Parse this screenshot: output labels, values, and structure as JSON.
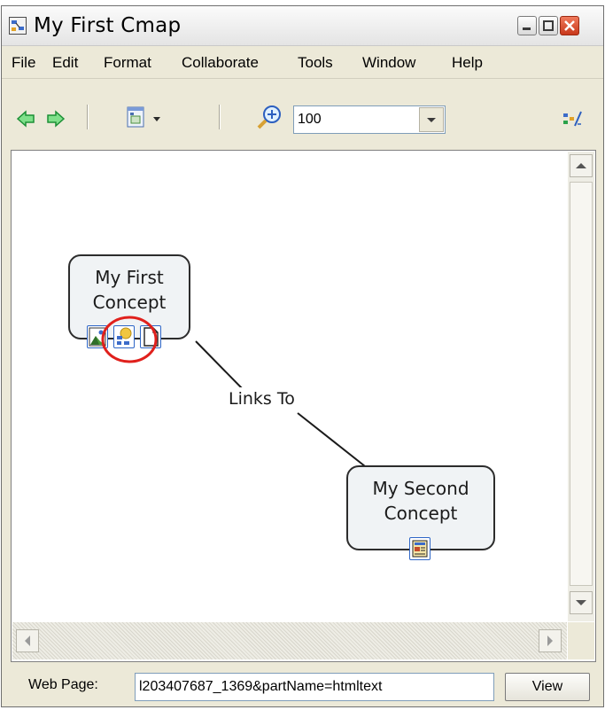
{
  "window": {
    "title": "My First Cmap",
    "controls": {
      "minimize": "minimize-icon",
      "maximize": "maximize-icon",
      "close": "close-icon"
    }
  },
  "menu": {
    "items": [
      {
        "label": "File"
      },
      {
        "label": "Edit"
      },
      {
        "label": "Format"
      },
      {
        "label": "Collaborate"
      },
      {
        "label": "Tools"
      },
      {
        "label": "Window"
      },
      {
        "label": "Help"
      }
    ]
  },
  "toolbar": {
    "icons": [
      "back-arrow-icon",
      "forward-arrow-icon",
      "view-options-icon",
      "zoom-in-icon",
      "styles-icon"
    ],
    "zoom_value": "100"
  },
  "cmap": {
    "concept_1": {
      "line1": "My First",
      "line2": "Concept",
      "resources": [
        "image-resource-icon",
        "cmap-resource-icon",
        "document-resource-icon"
      ]
    },
    "link_label": "Links To",
    "concept_2": {
      "line1": "My Second",
      "line2": "Concept",
      "resources": [
        "webpage-resource-icon"
      ]
    },
    "highlight_color": "#e0201c"
  },
  "status": {
    "label": "Web Page:",
    "value": "l203407687_1369&partName=htmltext",
    "view_button": "View"
  },
  "colors": {
    "window_bg": "#ece9d8",
    "arrow_green": "#2fb24a",
    "resource_border": "#2e66c7"
  }
}
